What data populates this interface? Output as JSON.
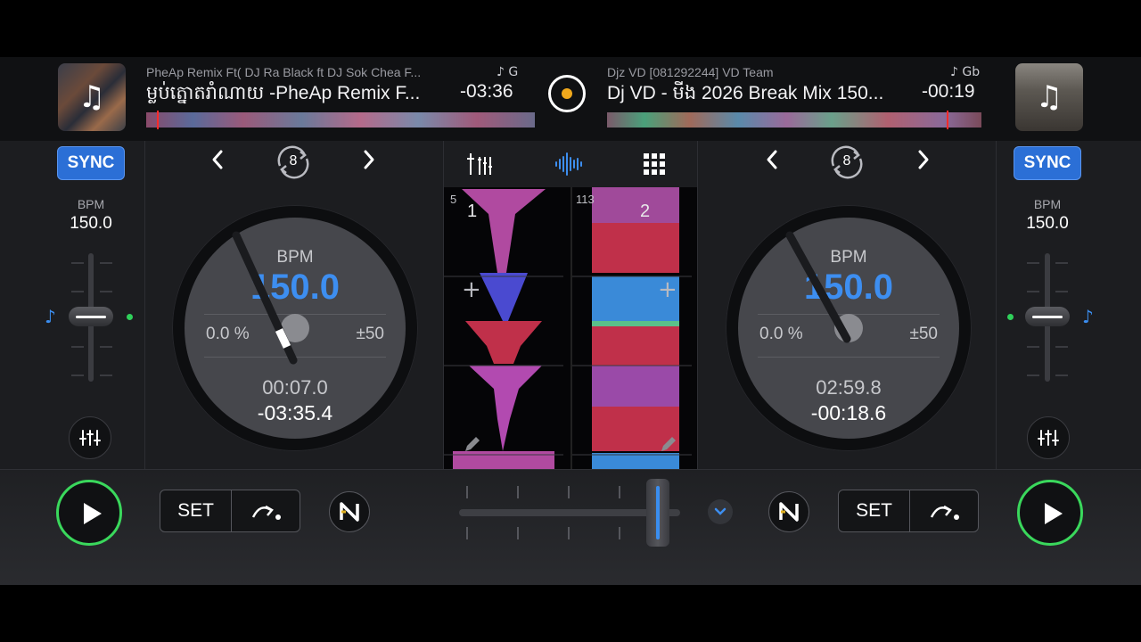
{
  "deck_a": {
    "artist": "PheAp Remix Ft( DJ Ra Black ft DJ Sok Chea F...",
    "title": "ម្លប់ត្នោតរាំណាយ -PheAp Remix F...",
    "key": "♪ G",
    "remaining": "-03:36",
    "sync_label": "SYNC",
    "bpm_label": "BPM",
    "bpm_value": "150.0",
    "loop_value": "8",
    "platter": {
      "bpm_label": "BPM",
      "bpm": "150.0",
      "pitch_percent": "0.0 %",
      "pitch_range": "±50",
      "elapsed": "00:07.0",
      "remaining": "-03:35.4"
    },
    "set_label": "SET",
    "wave_lane_number": "5",
    "deck_number": "1"
  },
  "deck_b": {
    "artist": "Djz VD [081292244] VD Team",
    "title": "Dj VD - មីង 2026 Break Mix 150...",
    "key": "♪ Gb",
    "remaining": "-00:19",
    "sync_label": "SYNC",
    "bpm_label": "BPM",
    "bpm_value": "150.0",
    "loop_value": "8",
    "platter": {
      "bpm_label": "BPM",
      "bpm": "150.0",
      "pitch_percent": "0.0 %",
      "pitch_range": "±50",
      "elapsed": "02:59.8",
      "remaining": "-00:18.6"
    },
    "set_label": "SET",
    "wave_lane_number": "113",
    "deck_number": "2"
  },
  "icons": {
    "cover_note": "♫",
    "prev": "‹",
    "next": "›",
    "pitch_note": "♪",
    "plus": "+"
  },
  "colors": {
    "accent_blue": "#3d8ef0",
    "sync_blue": "#2b6fd6",
    "play_green": "#3ad85c",
    "record_orange": "#f0a81c",
    "marker_red": "#ff2a2a"
  }
}
